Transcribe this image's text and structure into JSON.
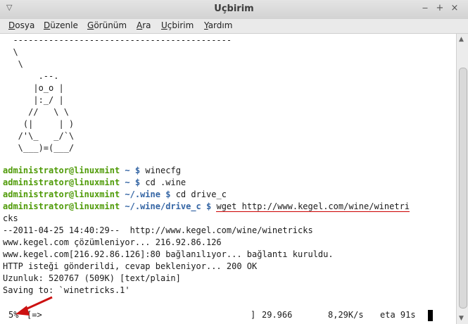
{
  "window": {
    "title": "Uçbirim",
    "controls": {
      "minimize": "‒",
      "maximize": "+",
      "close": "×"
    }
  },
  "menubar": {
    "items": [
      "Dosya",
      "Düzenle",
      "Görünüm",
      "Ara",
      "Uçbirim",
      "Yardım"
    ]
  },
  "terminal": {
    "ascii_art": [
      "  -------------------------------------------",
      "  \\",
      "   \\",
      "       .--.",
      "      |o_o |",
      "      |:_/ |",
      "     //   \\ \\",
      "    (|     | )",
      "   /'\\_   _/`\\",
      "   \\___)=(___/"
    ],
    "commands": [
      {
        "user": "administrator@linuxmint",
        "path": "~",
        "symbol": "$",
        "cmd": "winecfg"
      },
      {
        "user": "administrator@linuxmint",
        "path": "~",
        "symbol": "$",
        "cmd": "cd .wine"
      },
      {
        "user": "administrator@linuxmint",
        "path": "~/.wine",
        "symbol": "$",
        "cmd": "cd drive_c"
      },
      {
        "user": "administrator@linuxmint",
        "path": "~/.wine/drive_c",
        "symbol": "$",
        "cmd": "wget http://www.kegel.com/wine/winetri"
      }
    ],
    "wrapped_line": "cks",
    "output": [
      "--2011-04-25 14:40:29--  http://www.kegel.com/wine/winetricks",
      "www.kegel.com çözümleniyor... 216.92.86.126",
      "www.kegel.com[216.92.86.126]:80 bağlanılıyor... bağlantı kuruldu.",
      "HTTP isteği gönderildi, cevap bekleniyor... 200 OK",
      "Uzunluk: 520767 (509K) [text/plain]",
      "Saving to: `winetricks.1'"
    ],
    "progress": {
      "percent": "5%",
      "bar": "[=>",
      "bar_end": "]",
      "bytes": "29.966",
      "speed": "8,29K/s",
      "eta": "eta 91s",
      "fraction": 0.05
    }
  },
  "colors": {
    "prompt_user": "#4e9a06",
    "prompt_path": "#3465a4",
    "annotation_arrow": "#cc1111",
    "underline": "#cc0000"
  }
}
